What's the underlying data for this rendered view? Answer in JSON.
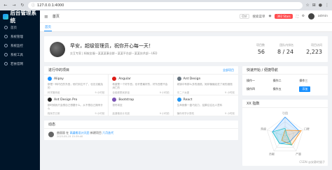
{
  "browser": {
    "url": "127.0.0.1:4000",
    "back": "←",
    "forward": "→",
    "reload": "↻"
  },
  "sidebar": {
    "title": "后台管理系统",
    "items": [
      {
        "label": "首页"
      },
      {
        "label": "系统管理"
      },
      {
        "label": "系统监控"
      },
      {
        "label": "系统工具"
      },
      {
        "label": "若依官网"
      }
    ]
  },
  "topbar": {
    "breadcrumb": "首页",
    "ctrl": "Ctrl",
    "search_label": "搜索菜单",
    "stars": "392 Stars",
    "username": "admin"
  },
  "tabs": [
    {
      "label": "首页"
    }
  ],
  "welcome": {
    "greeting": "早安，超级管理员，祝你开心每一天！",
    "subtitle": "交互专家 | 蚂蚁金服－某某某事业群－某某平台部－某某技术部－UED",
    "stats": [
      {
        "label": "项目数",
        "value": "56"
      },
      {
        "label": "团队内排名",
        "value": "8 / 24"
      },
      {
        "label": "项目访问",
        "value": "2,223"
      }
    ]
  },
  "projects": {
    "title": "进行中的项目",
    "all_link": "全部项目",
    "items": [
      {
        "name": "Alipay",
        "desc": "那是一种内在的东西，他们到达不了，也无法触及的",
        "team": "科学搬砖组",
        "time": "9 小时前",
        "color": "#1890ff"
      },
      {
        "name": "Angular",
        "desc": "希望是一个好东西，也许是最好的，好东西是不会消亡的",
        "team": "全组都是吴彦祖",
        "time": "9 小时前",
        "color": "#dd1b16"
      },
      {
        "name": "Ant Design",
        "desc": "城镇中有那么多的酒馆，她却偏偏走进了我的酒馆",
        "team": "中二少女团",
        "time": "9 小时前",
        "color": "#6a7782"
      },
      {
        "name": "Ant Design Pro",
        "desc": "那时候我只会想自己想要什么，从不想自己拥有什么",
        "team": "程序员日常",
        "time": "9 小时前",
        "color": "#222222"
      },
      {
        "name": "Bootstrap",
        "desc": "凛冬将至",
        "team": "高逼格设计天团",
        "time": "9 小时前",
        "color": "#7952b3"
      },
      {
        "name": "React",
        "desc": "生命就像一盒巧克力，结果往往出人意料",
        "team": "骗你来学计算机",
        "time": "9 小时前",
        "color": "#2196f3"
      }
    ]
  },
  "activity": {
    "title": "动态",
    "items": [
      {
        "user": "曲丽丽",
        "action": "在",
        "group": "高逼格设计天团",
        "verb": "新建项目",
        "target": "六月迭代",
        "time": "2023-05-15 15:39:40"
      }
    ]
  },
  "quick": {
    "title": "快速开始 / 便捷导航",
    "items": [
      {
        "label": "操作一"
      },
      {
        "label": "操作二"
      },
      {
        "label": "操作三"
      },
      {
        "label": "操作四"
      },
      {
        "label": "操作五"
      },
      {
        "label": "添加"
      }
    ]
  },
  "radar": {
    "title": "XX 指数",
    "axes": [
      "引用",
      "口碑",
      "产量",
      "贡献",
      "热度"
    ],
    "series": [
      {
        "values": [
          10,
          8,
          4,
          5,
          7
        ],
        "color": "#1890ff"
      },
      {
        "values": [
          3,
          9,
          6,
          3,
          1
        ],
        "color": "#fa8c16"
      },
      {
        "values": [
          4,
          1,
          6,
          5,
          7
        ],
        "color": "#13c2c2"
      }
    ],
    "max": 10
  },
  "watermark": "CSDN @安静的猫子"
}
